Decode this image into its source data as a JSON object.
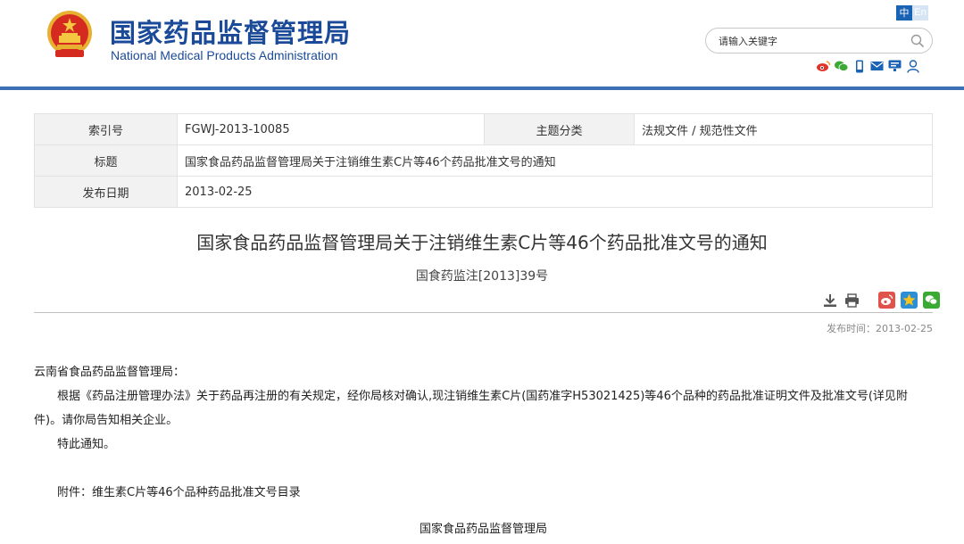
{
  "header": {
    "title_cn": "国家药品监督管理局",
    "title_en": "National Medical Products Administration",
    "lang_zh": "中",
    "lang_en": "En",
    "search_placeholder": "请输入关键字",
    "social_icons": [
      "weibo-icon",
      "wechat-icon",
      "mobile-icon",
      "mail-icon",
      "feedback-icon",
      "user-icon"
    ],
    "colors": {
      "brand_blue": "#1a4a98",
      "rule_blue": "#3d6fb6"
    }
  },
  "meta": {
    "index_label": "索引号",
    "index_value": "FGWJ-2013-10085",
    "category_label": "主题分类",
    "category_value": "法规文件 / 规范性文件",
    "title_label": "标题",
    "title_value": "国家食品药品监督管理局关于注销维生素C片等46个药品批准文号的通知",
    "date_label": "发布日期",
    "date_value": "2013-02-25"
  },
  "document": {
    "title": "国家食品药品监督管理局关于注销维生素C片等46个药品批准文号的通知",
    "doc_number": "国食药监注[2013]39号",
    "publish_time": "发布时间：2013-02-25",
    "tool_icons": [
      "download-icon",
      "print-icon",
      "weibo-share-icon",
      "qzone-share-icon",
      "wechat-share-icon"
    ],
    "salutation": "云南省食品药品监督管理局：",
    "paragraph1": "根据《药品注册管理办法》关于药品再注册的有关规定，经你局核对确认,现注销维生素C片(国药准字H53021425)等46个品种的药品批准证明文件及批准文号(详见附件)。请你局告知相关企业。",
    "paragraph2": "特此通知。",
    "attachment": "附件：维生素C片等46个品种药品批准文号目录",
    "signature": "国家食品药品监督管理局"
  }
}
